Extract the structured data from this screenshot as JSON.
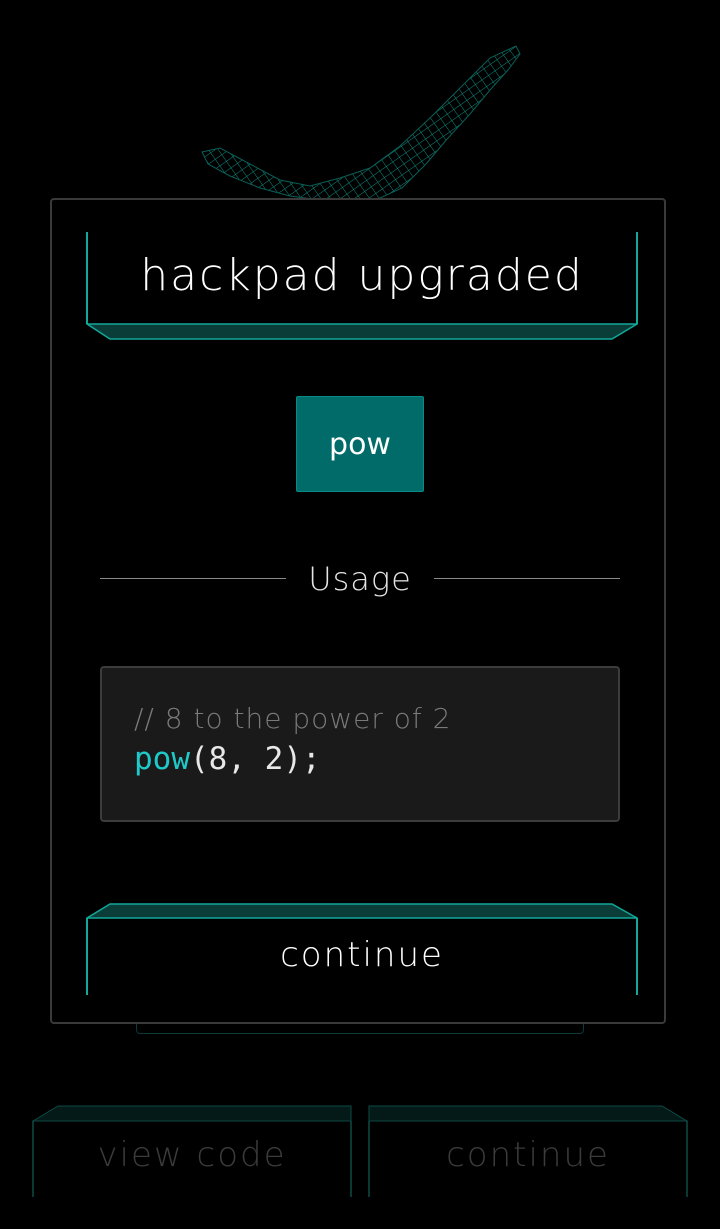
{
  "modal": {
    "title": "hackpad upgraded",
    "function_name": "pow",
    "section_label": "Usage",
    "code": {
      "comment": "// 8 to the power of 2",
      "fn": "pow",
      "args": "(8, 2);"
    },
    "continue_label": "continue"
  },
  "background": {
    "view_code_label": "view code",
    "continue_label": "continue"
  },
  "colors": {
    "accent": "#1fc9c9",
    "badge": "#006b68",
    "teal_line": "#12a89a",
    "bg": "#000000"
  },
  "icons": {
    "bg_shape": "voxel-grid-icon"
  }
}
